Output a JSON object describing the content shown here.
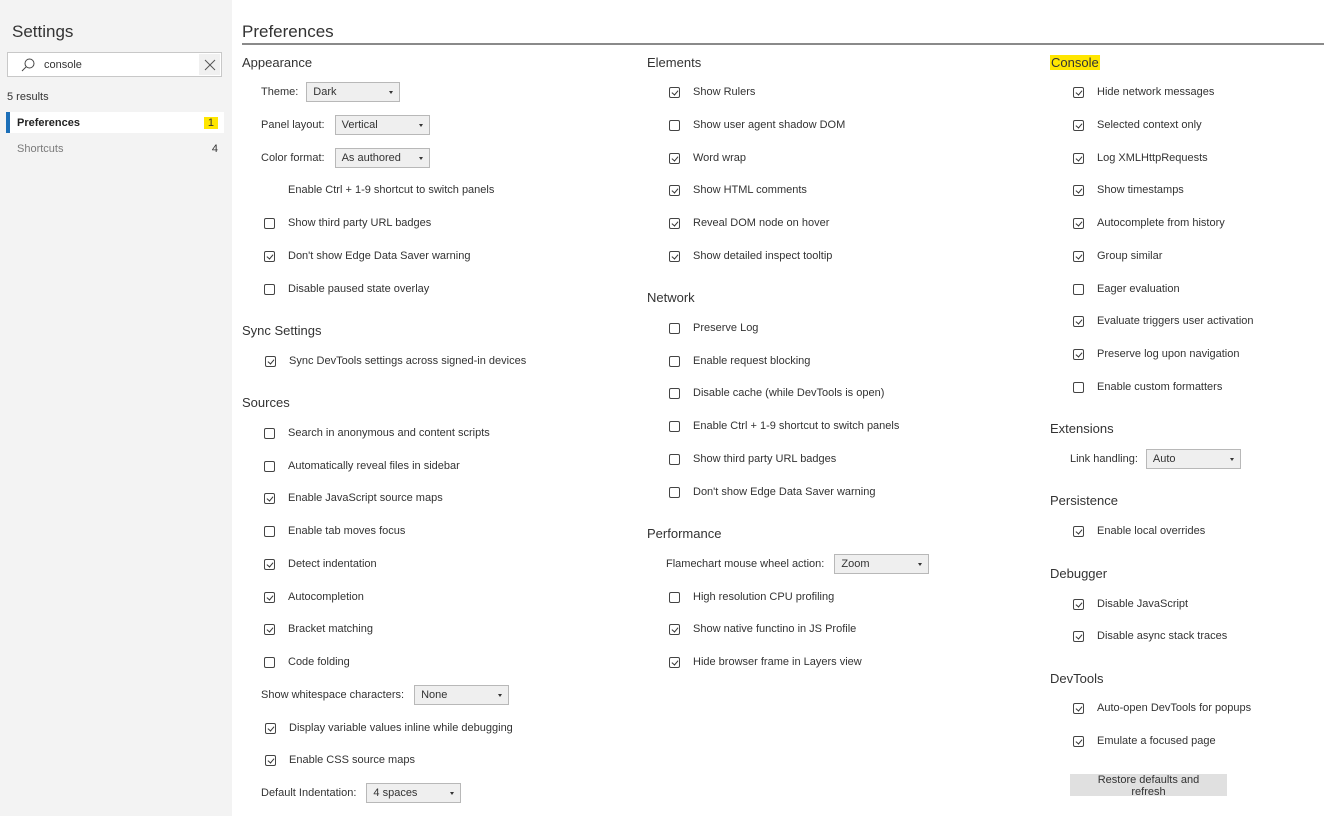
{
  "sidebar": {
    "title": "Settings",
    "search": {
      "value": "console",
      "placeholder": ""
    },
    "results_count": "5 results",
    "items": [
      {
        "label": "Preferences",
        "count": "1",
        "active": true
      },
      {
        "label": "Shortcuts",
        "count": "4",
        "active": false
      }
    ]
  },
  "main": {
    "title": "Preferences",
    "appearance": {
      "title": "Appearance",
      "theme": {
        "label": "Theme:",
        "value": "Dark"
      },
      "panel_layout": {
        "label": "Panel layout:",
        "value": "Vertical"
      },
      "color_format": {
        "label": "Color format:",
        "value": "As authored"
      },
      "ctrl_note": "Enable Ctrl + 1-9 shortcut to switch panels",
      "checkboxes": [
        {
          "label": "Show third party URL badges",
          "checked": false
        },
        {
          "label": "Don't show Edge Data Saver warning",
          "checked": true
        },
        {
          "label": "Disable paused state overlay",
          "checked": false
        }
      ]
    },
    "sync": {
      "title": "Sync Settings",
      "checkboxes": [
        {
          "label": "Sync DevTools settings across signed-in devices",
          "checked": true
        }
      ]
    },
    "sources": {
      "title": "Sources",
      "checkboxes": [
        {
          "label": "Search in anonymous and content scripts",
          "checked": false
        },
        {
          "label": "Automatically reveal files in sidebar",
          "checked": false
        },
        {
          "label": "Enable JavaScript source maps",
          "checked": true
        },
        {
          "label": "Enable tab moves focus",
          "checked": false
        },
        {
          "label": "Detect indentation",
          "checked": true
        },
        {
          "label": "Autocompletion",
          "checked": true
        },
        {
          "label": "Bracket matching",
          "checked": true
        },
        {
          "label": "Code folding",
          "checked": false
        }
      ],
      "whitespace": {
        "label": "Show whitespace characters:",
        "value": "None"
      },
      "checkboxes2": [
        {
          "label": "Display variable values inline while debugging",
          "checked": true
        },
        {
          "label": "Enable CSS source maps",
          "checked": true
        }
      ],
      "indentation": {
        "label": "Default Indentation:",
        "value": "4 spaces"
      }
    },
    "elements": {
      "title": "Elements",
      "checkboxes": [
        {
          "label": "Show Rulers",
          "checked": true
        },
        {
          "label": "Show user agent shadow DOM",
          "checked": false
        },
        {
          "label": "Word wrap",
          "checked": true
        },
        {
          "label": "Show HTML comments",
          "checked": true
        },
        {
          "label": "Reveal DOM node on hover",
          "checked": true
        },
        {
          "label": "Show detailed inspect tooltip",
          "checked": true
        }
      ]
    },
    "network": {
      "title": "Network",
      "checkboxes": [
        {
          "label": "Preserve Log",
          "checked": false
        },
        {
          "label": "Enable request blocking",
          "checked": false
        },
        {
          "label": "Disable cache (while DevTools is open)",
          "checked": false
        },
        {
          "label": "Enable Ctrl + 1-9 shortcut to switch panels",
          "checked": false
        },
        {
          "label": "Show third party URL badges",
          "checked": false
        },
        {
          "label": "Don't show Edge Data Saver warning",
          "checked": false
        }
      ]
    },
    "performance": {
      "title": "Performance",
      "flamechart": {
        "label": "Flamechart mouse wheel action:",
        "value": "Zoom"
      },
      "checkboxes": [
        {
          "label": "High resolution CPU profiling",
          "checked": false
        },
        {
          "label": "Show native functino in JS Profile",
          "checked": true
        },
        {
          "label": "Hide browser frame in Layers view",
          "checked": true
        }
      ]
    },
    "console": {
      "title": "Console",
      "highlight_color": "#ffe600",
      "checkboxes": [
        {
          "label": "Hide network messages",
          "checked": true
        },
        {
          "label": "Selected context only",
          "checked": true
        },
        {
          "label": "Log XMLHttpRequests",
          "checked": true
        },
        {
          "label": "Show timestamps",
          "checked": true
        },
        {
          "label": "Autocomplete from history",
          "checked": true
        },
        {
          "label": "Group similar",
          "checked": true
        },
        {
          "label": "Eager evaluation",
          "checked": false
        },
        {
          "label": "Evaluate triggers user activation",
          "checked": true
        },
        {
          "label": "Preserve log upon navigation",
          "checked": true
        },
        {
          "label": "Enable custom formatters",
          "checked": false
        }
      ]
    },
    "extensions": {
      "title": "Extensions",
      "link_handling": {
        "label": "Link handling:",
        "value": "Auto"
      }
    },
    "persistence": {
      "title": "Persistence",
      "checkboxes": [
        {
          "label": "Enable local overrides",
          "checked": true
        }
      ]
    },
    "debugger": {
      "title": "Debugger",
      "checkboxes": [
        {
          "label": "Disable JavaScript",
          "checked": true
        },
        {
          "label": "Disable async stack traces",
          "checked": true
        }
      ]
    },
    "devtools": {
      "title": "DevTools",
      "checkboxes": [
        {
          "label": "Auto-open DevTools for popups",
          "checked": true
        },
        {
          "label": "Emulate a focused page",
          "checked": true
        }
      ],
      "restore_label": "Restore defaults and refresh"
    }
  }
}
